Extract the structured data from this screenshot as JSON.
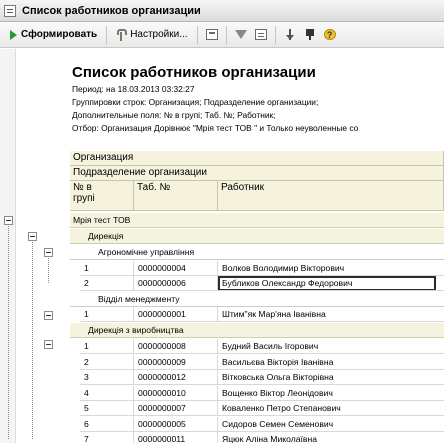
{
  "window": {
    "title": "Список работников организации"
  },
  "toolbar": {
    "generate_label": "Сформировать",
    "settings_label": "Настройки..."
  },
  "report": {
    "title": "Список работников организации",
    "period": "Период: на 18.03.2013 03:32:27",
    "groupings": "Группировки строк: Организация; Подразделение организации;",
    "extra_fields": "Дополнительные поля: № в групі; Таб. №; Работник;",
    "filter": "Отбор: Организация Дорівнює \"Мрія тест ТОВ \" и Только неуволенные со"
  },
  "header": {
    "organization": "Организация",
    "department": "Подразделение организации",
    "num_line1": "№ в",
    "num_line2": "групі",
    "tab_num": "Таб. №",
    "employee": "Работник"
  },
  "groups": {
    "org": "Мрія тест ТОВ",
    "dept1": "Дирекція",
    "dept1_sub": "Агрономічне управління",
    "dept2": "Відділ менеджменту",
    "dept3": "Дирекція з виробництва"
  },
  "rows_a": [
    {
      "n": "1",
      "tab": "0000000004",
      "name": "Волков Володимир Вікторович"
    },
    {
      "n": "2",
      "tab": "0000000006",
      "name": "Бубликов Олександр Федорович"
    }
  ],
  "rows_b": [
    {
      "n": "1",
      "tab": "0000000001",
      "name": "Штим\"як Мар'яна Іванівна"
    }
  ],
  "rows_c": [
    {
      "n": "1",
      "tab": "0000000008",
      "name": "Будний Василь Ігорович"
    },
    {
      "n": "2",
      "tab": "0000000009",
      "name": "Васильєва Вікторія Іванівна"
    },
    {
      "n": "3",
      "tab": "0000000012",
      "name": "Вітковська Ольга Вікторівна"
    },
    {
      "n": "4",
      "tab": "0000000010",
      "name": "Вощенко Віктор Леонідович"
    },
    {
      "n": "5",
      "tab": "0000000007",
      "name": "Коваленко Петро Степанович"
    },
    {
      "n": "6",
      "tab": "0000000005",
      "name": "Сидоров Семен Семенович"
    },
    {
      "n": "7",
      "tab": "0000000011",
      "name": "Яцюк Аліна Миколаївна"
    }
  ]
}
